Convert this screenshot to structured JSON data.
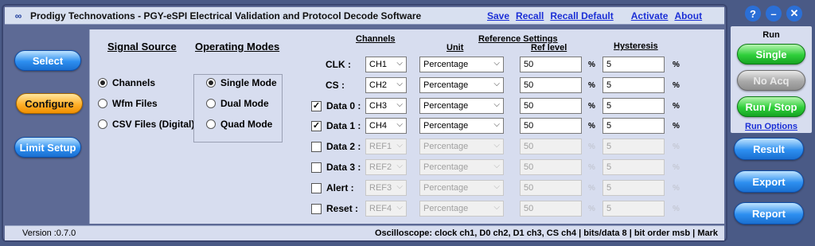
{
  "window": {
    "title": "Prodigy Technovations - PGY-eSPI Electrical Validation and Protocol Decode Software",
    "menu": [
      "Save",
      "Recall",
      "Recall Default",
      "Activate",
      "About"
    ]
  },
  "nav": {
    "select": "Select",
    "configure": "Configure",
    "limit_setup": "Limit Setup"
  },
  "signal_source": {
    "heading": "Signal Source",
    "options": [
      "Channels",
      "Wfm Files",
      "CSV Files (Digital)"
    ],
    "selected": "Channels"
  },
  "operating_modes": {
    "heading": "Operating Modes",
    "options": [
      "Single Mode",
      "Dual Mode",
      "Quad Mode"
    ],
    "selected": "Single Mode"
  },
  "headers": {
    "channels": "Channels",
    "reference_settings": "Reference Settings",
    "unit": "Unit",
    "ref_level": "Ref level",
    "hysteresis": "Hysteresis"
  },
  "rows": [
    {
      "label": "CLK :",
      "checkbox": null,
      "channel": "CH1",
      "unit": "Percentage",
      "ref_level": "50",
      "pct1": "%",
      "hysteresis": "5",
      "pct2": "%",
      "enabled": true
    },
    {
      "label": "CS :",
      "checkbox": null,
      "channel": "CH2",
      "unit": "Percentage",
      "ref_level": "50",
      "pct1": "%",
      "hysteresis": "5",
      "pct2": "%",
      "enabled": true
    },
    {
      "label": "Data 0 :",
      "checkbox": "checked",
      "channel": "CH3",
      "unit": "Percentage",
      "ref_level": "50",
      "pct1": "%",
      "hysteresis": "5",
      "pct2": "%",
      "enabled": true
    },
    {
      "label": "Data 1 :",
      "checkbox": "checked",
      "channel": "CH4",
      "unit": "Percentage",
      "ref_level": "50",
      "pct1": "%",
      "hysteresis": "5",
      "pct2": "%",
      "enabled": true
    },
    {
      "label": "Data 2 :",
      "checkbox": "unchecked",
      "channel": "REF1",
      "unit": "Percentage",
      "ref_level": "50",
      "pct1": "%",
      "hysteresis": "5",
      "pct2": "%",
      "enabled": false
    },
    {
      "label": "Data 3 :",
      "checkbox": "unchecked",
      "channel": "REF2",
      "unit": "Percentage",
      "ref_level": "50",
      "pct1": "%",
      "hysteresis": "5",
      "pct2": "%",
      "enabled": false
    },
    {
      "label": "Alert :",
      "checkbox": "unchecked",
      "channel": "REF3",
      "unit": "Percentage",
      "ref_level": "50",
      "pct1": "%",
      "hysteresis": "5",
      "pct2": "%",
      "enabled": false
    },
    {
      "label": "Reset :",
      "checkbox": "unchecked",
      "channel": "REF4",
      "unit": "Percentage",
      "ref_level": "50",
      "pct1": "%",
      "hysteresis": "5",
      "pct2": "%",
      "enabled": false
    }
  ],
  "status": {
    "version": "Version :0.7.0",
    "text": "Oscilloscope: clock ch1, D0 ch2, D1 ch3, CS ch4 | bits/data 8 | bit order msb | Mark"
  },
  "run": {
    "heading": "Run",
    "single": "Single",
    "no_acq": "No Acq",
    "run_stop": "Run / Stop",
    "run_options": "Run Options"
  },
  "actions": {
    "result": "Result",
    "export": "Export",
    "report": "Report"
  },
  "icons": {
    "help": "help-icon",
    "minimize": "minimize-icon",
    "close": "close-icon",
    "app": "app-logo-icon"
  },
  "colors": {
    "accent_blue": "#2d8ff0",
    "active_orange": "#ffb02a",
    "run_green": "#2fcf3a",
    "panel_bg": "#d7ddef",
    "frame_bg": "#5d6a95"
  }
}
